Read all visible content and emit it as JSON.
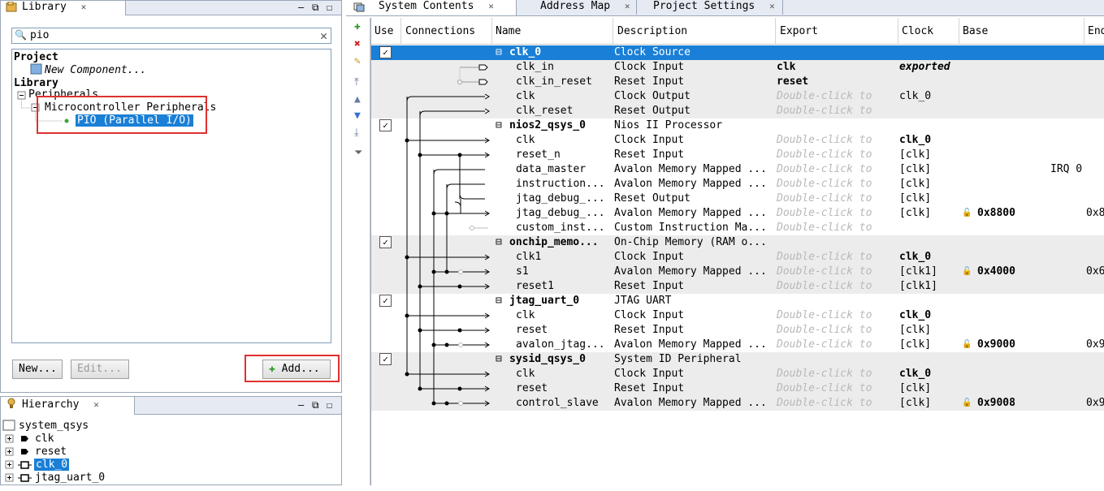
{
  "library": {
    "tab": "Library",
    "search": "pio",
    "tree": [
      {
        "text": "Project",
        "bold": true
      },
      {
        "text": "New Component...",
        "italic": true
      },
      {
        "text": "Library",
        "bold": true
      },
      {
        "text": "Peripherals"
      },
      {
        "text": "Microcontroller Peripherals"
      },
      {
        "text": "PIO (Parallel I/O)",
        "selected": true
      }
    ],
    "new_label": "New...",
    "edit_label": "Edit...",
    "add_label": "Add..."
  },
  "hierarchy": {
    "tab": "Hierarchy",
    "items": [
      "system_qsys",
      "clk",
      "reset",
      "clk_0",
      "jtag_uart_0"
    ]
  },
  "tabs": [
    "System Contents",
    "Address Map",
    "Project Settings"
  ],
  "columns": [
    "Use",
    "Connections",
    "Name",
    "Description",
    "Export",
    "Clock",
    "Base",
    "End"
  ],
  "rows": [
    {
      "use": true,
      "name": "clk_0",
      "desc": "Clock Source",
      "export": "",
      "clock": "",
      "base": "",
      "selected": true,
      "component": true
    },
    {
      "name": "clk_in",
      "desc": "Clock Input",
      "export": "clk",
      "export_bold": true,
      "clock": "exported",
      "clock_style": "bi"
    },
    {
      "name": "clk_in_reset",
      "desc": "Reset Input",
      "export": "reset",
      "export_bold": true,
      "clock": ""
    },
    {
      "name": "clk",
      "desc": "Clock Output",
      "export": "Double-click to",
      "clock": "clk_0"
    },
    {
      "name": "clk_reset",
      "desc": "Reset Output",
      "export": "Double-click to",
      "clock": ""
    },
    {
      "use": true,
      "name": "nios2_qsys_0",
      "desc": "Nios II Processor",
      "component": true
    },
    {
      "name": "clk",
      "desc": "Clock Input",
      "export": "Double-click to",
      "clock": "clk_0",
      "clock_style": "b"
    },
    {
      "name": "reset_n",
      "desc": "Reset Input",
      "export": "Double-click to",
      "clock": "[clk]"
    },
    {
      "name": "data_master",
      "desc": "Avalon Memory Mapped ...",
      "export": "Double-click to",
      "clock": "[clk]",
      "base": "IRQ 0",
      "base_right": true
    },
    {
      "name": "instruction...",
      "desc": "Avalon Memory Mapped ...",
      "export": "Double-click to",
      "clock": "[clk]"
    },
    {
      "name": "jtag_debug_...",
      "desc": "Reset Output",
      "export": "Double-click to",
      "clock": "[clk]"
    },
    {
      "name": "jtag_debug_...",
      "desc": "Avalon Memory Mapped ...",
      "export": "Double-click to",
      "clock": "[clk]",
      "base": "0x8800",
      "lock": true,
      "end": "0x8"
    },
    {
      "name": "custom_inst...",
      "desc": "Custom Instruction Ma...",
      "export": "Double-click to",
      "clock": ""
    },
    {
      "use": true,
      "name": "onchip_memo...",
      "desc": "On-Chip Memory (RAM o...",
      "component": true
    },
    {
      "name": "clk1",
      "desc": "Clock Input",
      "export": "Double-click to",
      "clock": "clk_0",
      "clock_style": "b"
    },
    {
      "name": "s1",
      "desc": "Avalon Memory Mapped ...",
      "export": "Double-click to",
      "clock": "[clk1]",
      "base": "0x4000",
      "lock": true,
      "end": "0x6"
    },
    {
      "name": "reset1",
      "desc": "Reset Input",
      "export": "Double-click to",
      "clock": "[clk1]"
    },
    {
      "use": true,
      "name": "jtag_uart_0",
      "desc": "JTAG UART",
      "component": true
    },
    {
      "name": "clk",
      "desc": "Clock Input",
      "export": "Double-click to",
      "clock": "clk_0",
      "clock_style": "b"
    },
    {
      "name": "reset",
      "desc": "Reset Input",
      "export": "Double-click to",
      "clock": "[clk]"
    },
    {
      "name": "avalon_jtag...",
      "desc": "Avalon Memory Mapped ...",
      "export": "Double-click to",
      "clock": "[clk]",
      "base": "0x9000",
      "lock": true,
      "end": "0x9"
    },
    {
      "use": true,
      "name": "sysid_qsys_0",
      "desc": "System ID Peripheral",
      "component": true
    },
    {
      "name": "clk",
      "desc": "Clock Input",
      "export": "Double-click to",
      "clock": "clk_0",
      "clock_style": "b"
    },
    {
      "name": "reset",
      "desc": "Reset Input",
      "export": "Double-click to",
      "clock": "[clk]"
    },
    {
      "name": "control_slave",
      "desc": "Avalon Memory Mapped ...",
      "export": "Double-click to",
      "clock": "[clk]",
      "base": "0x9008",
      "lock": true,
      "end": "0x9"
    }
  ],
  "colors": {
    "selection": "#1a7fd6",
    "band": "#ececec",
    "highlight_box": "#e03030"
  },
  "icons": [
    "library-icon",
    "hierarchy-icon",
    "system-contents-icon",
    "add-icon",
    "remove-icon",
    "edit-icon",
    "move-top-icon",
    "move-up-icon",
    "move-down-icon",
    "move-bottom-icon",
    "filter-icon"
  ]
}
